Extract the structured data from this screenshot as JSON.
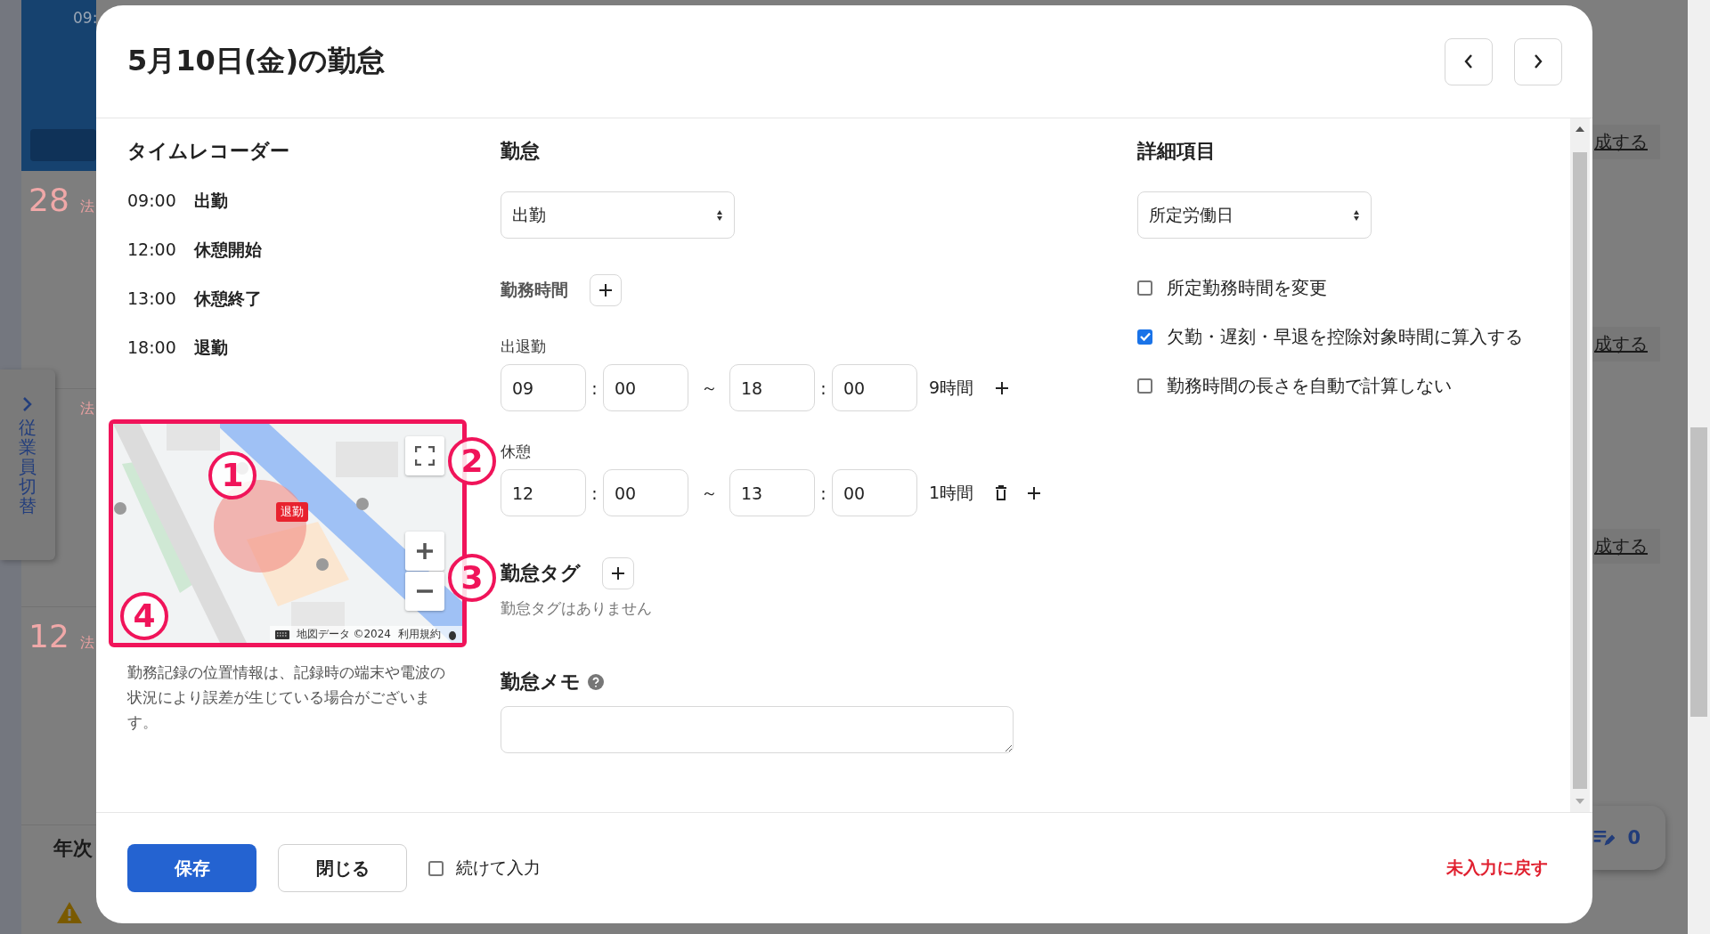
{
  "background": {
    "time_label": "09:",
    "rows": [
      {
        "date": "28",
        "note": "法"
      },
      {
        "date": "",
        "note": "法"
      },
      {
        "date": "12",
        "note": "法"
      }
    ],
    "side_tab": {
      "label": "従業員切替"
    },
    "section_title": "年次",
    "links": [
      "成する",
      "成する",
      "成する"
    ],
    "fab": {
      "count": "0"
    }
  },
  "dialog": {
    "title": "5月10日(金)の勤怠",
    "time_recorder": {
      "title": "タイムレコーダー",
      "entries": [
        {
          "time": "09:00",
          "label": "出勤"
        },
        {
          "time": "12:00",
          "label": "休憩開始"
        },
        {
          "time": "13:00",
          "label": "休憩終了"
        },
        {
          "time": "18:00",
          "label": "退勤"
        }
      ],
      "map": {
        "marker": "退勤",
        "attribution": "地図データ ©2024",
        "terms": "利用規約"
      },
      "note": "勤務記録の位置情報は、記録時の端末や電波の状況により誤差が生じている場合がございます。"
    },
    "attendance": {
      "title": "勤怠",
      "select": "出勤",
      "work_hours_title": "勤務時間",
      "shifts": [
        {
          "label": "出退勤",
          "start": [
            "09",
            "00"
          ],
          "colon_start": ":",
          "tilde": "～",
          "end": [
            "18",
            "00"
          ],
          "colon_end": ":",
          "duration": "9時間",
          "kind": "add"
        },
        {
          "label": "休憩",
          "start": [
            "12",
            "00"
          ],
          "colon_start": ":",
          "tilde": "～",
          "end": [
            "13",
            "00"
          ],
          "colon_end": ":",
          "duration": "1時間",
          "kind": "delete"
        }
      ],
      "tags_title": "勤怠タグ",
      "tags_empty": "勤怠タグはありません",
      "memo_title": "勤怠メモ"
    },
    "details": {
      "title": "詳細項目",
      "select": "所定労働日",
      "options": [
        {
          "label": "所定勤務時間を変更",
          "checked": false
        },
        {
          "label": "欠勤・遅刻・早退を控除対象時間に算入する",
          "checked": true
        },
        {
          "label": "勤務時間の長さを自動で計算しない",
          "checked": false
        }
      ]
    },
    "footer": {
      "save": "保存",
      "close": "閉じる",
      "continue": {
        "label": "続けて入力",
        "checked": false
      },
      "reset": "未入力に戻す"
    }
  },
  "annotations": [
    "1",
    "2",
    "3",
    "4"
  ]
}
